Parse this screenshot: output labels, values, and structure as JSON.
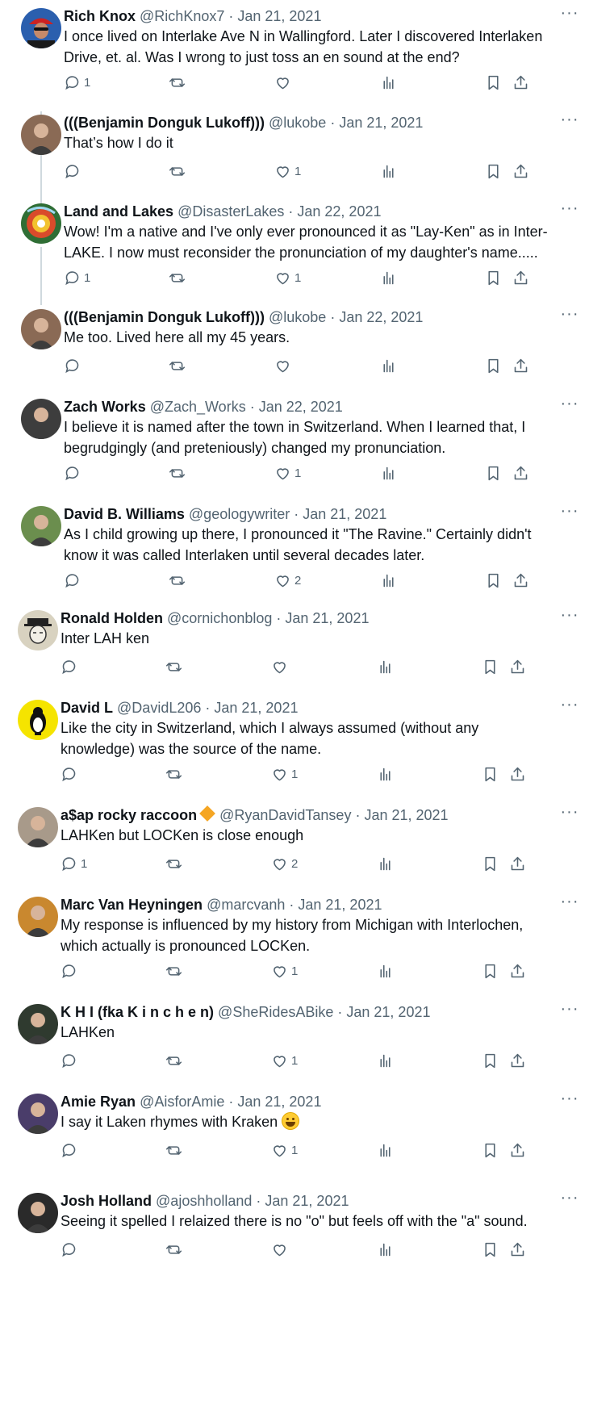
{
  "replies": [
    {
      "name": "Rich Knox",
      "handle": "@RichKnox7",
      "date": "Jan 21, 2021",
      "text": [
        "I once lived on Interlake Ave N in Wallingford. Later I discovered Interlaken",
        "Drive, et. al. Was I wrong to just toss an en sound at the end?"
      ],
      "reply_count": "1",
      "retweet_count": "",
      "like_count": "",
      "avatar_icon": "cyclist-avatar",
      "avatar_color": "#2b5fae"
    },
    {
      "name": "(((Benjamin Donguk Lukoff)))",
      "handle": "@lukobe",
      "date": "Jan 21, 2021",
      "text": [
        "That’s how I do it"
      ],
      "reply_count": "",
      "retweet_count": "",
      "like_count": "1",
      "avatar_icon": "person-avatar",
      "avatar_color": "#8a6a55"
    },
    {
      "name": "Land and Lakes",
      "handle": "@DisasterLakes",
      "date": "Jan 22, 2021",
      "text": [
        "Wow! I'm a native and I've only ever pronounced it as \"Lay-Ken\" as in Inter-",
        "LAKE. I now must reconsider the pronunciation of my daughter's name....."
      ],
      "reply_count": "1",
      "retweet_count": "",
      "like_count": "1",
      "avatar_icon": "hurricane-avatar",
      "avatar_color": "#3a7d3a"
    },
    {
      "name": "(((Benjamin Donguk Lukoff)))",
      "handle": "@lukobe",
      "date": "Jan 22, 2021",
      "text": [
        "Me too. Lived here all my 45 years."
      ],
      "reply_count": "",
      "retweet_count": "",
      "like_count": "",
      "avatar_icon": "person-avatar",
      "avatar_color": "#8a6a55"
    },
    {
      "name": "Zach Works",
      "handle": "@Zach_Works",
      "date": "Jan 22, 2021",
      "text": [
        "I believe it is named after the town in Switzerland. When I learned that, I",
        "begrudgingly (and preteniously) changed my pronunciation."
      ],
      "reply_count": "",
      "retweet_count": "",
      "like_count": "1",
      "avatar_icon": "person-avatar",
      "avatar_color": "#3d3d3d"
    },
    {
      "name": "David B. Williams",
      "handle": "@geologywriter",
      "date": "Jan 21, 2021",
      "text": [
        "As I child growing up there, I pronounced it \"The Ravine.\" Certainly didn't",
        "know it was called Interlaken until several decades later."
      ],
      "reply_count": "",
      "retweet_count": "",
      "like_count": "2",
      "avatar_icon": "person-avatar",
      "avatar_color": "#6b8e4e"
    },
    {
      "name": "Ronald Holden",
      "handle": "@cornichonblog",
      "date": "Jan 21, 2021",
      "text": [
        "Inter LAH ken"
      ],
      "reply_count": "",
      "retweet_count": "",
      "like_count": "",
      "avatar_icon": "sketch-avatar",
      "avatar_color": "#d8d2c0"
    },
    {
      "name": "David L",
      "handle": "@DavidL206",
      "date": "Jan 21, 2021",
      "text": [
        "Like the city in Switzerland, which I always assumed (without any",
        "knowledge) was the source of the name."
      ],
      "reply_count": "",
      "retweet_count": "",
      "like_count": "1",
      "avatar_icon": "penguin-avatar",
      "avatar_color": "#f5e400"
    },
    {
      "name": "a$ap rocky raccoon",
      "handle": "@RyanDavidTansey",
      "date": "Jan 21, 2021",
      "text": [
        "LAHKen but LOCKen is close enough"
      ],
      "reply_count": "1",
      "retweet_count": "",
      "like_count": "2",
      "avatar_icon": "person-avatar",
      "avatar_color": "#a89a8a"
    },
    {
      "name": "Marc Van Heyningen",
      "handle": "@marcvanh",
      "date": "Jan 21, 2021",
      "text": [
        "My response is influenced by my history from Michigan with Interlochen,",
        "which actually is pronounced LOCKen."
      ],
      "reply_count": "",
      "retweet_count": "",
      "like_count": "1",
      "avatar_icon": "person-avatar",
      "avatar_color": "#c9882f"
    },
    {
      "name": "K H I (fka K i n c h e n)",
      "handle": "@SheRidesABike",
      "date": "Jan 21, 2021",
      "text": [
        "LAHKen"
      ],
      "reply_count": "",
      "retweet_count": "",
      "like_count": "1",
      "avatar_icon": "person-avatar",
      "avatar_color": "#2f3a2f"
    },
    {
      "name": "Amie Ryan",
      "handle": "@AisforAmie",
      "date": "Jan 21, 2021",
      "text": [
        "I say it Laken rhymes with Kraken"
      ],
      "emoji": "grinning-face-icon",
      "reply_count": "",
      "retweet_count": "",
      "like_count": "1",
      "avatar_icon": "person-avatar",
      "avatar_color": "#4a3d6a"
    },
    {
      "name": "Josh Holland",
      "handle": "@ajoshholland",
      "date": "Jan 21, 2021",
      "text": [
        "Seeing it spelled I relaized there is no \"o\" but feels off with the \"a\" sound."
      ],
      "reply_count": "",
      "retweet_count": "",
      "like_count": "",
      "avatar_icon": "person-avatar",
      "avatar_color": "#2a2a2a"
    }
  ],
  "verified_badge_icon": "orange-diamond-icon",
  "accent_color": "#536471"
}
